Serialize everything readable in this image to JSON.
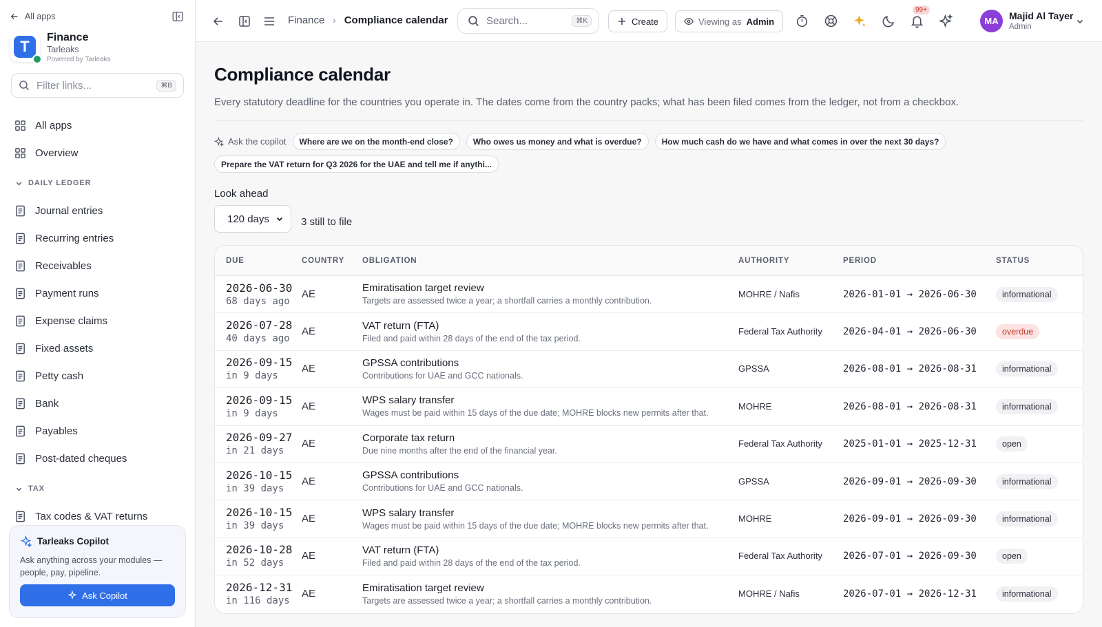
{
  "sidebar": {
    "back_label": "All apps",
    "org": {
      "name": "Finance",
      "company": "Tarleaks",
      "powered": "Powered by Tarleaks",
      "logo_letter": "T"
    },
    "filter_placeholder": "Filter links...",
    "filter_shortcut": "⌘B",
    "top_items": [
      {
        "label": "All apps",
        "icon": "grid-icon"
      },
      {
        "label": "Overview",
        "icon": "grid-icon"
      }
    ],
    "sections": [
      {
        "title": "DAILY LEDGER",
        "items": [
          {
            "label": "Journal entries"
          },
          {
            "label": "Recurring entries"
          },
          {
            "label": "Receivables"
          },
          {
            "label": "Payment runs"
          },
          {
            "label": "Expense claims"
          },
          {
            "label": "Fixed assets"
          },
          {
            "label": "Petty cash"
          },
          {
            "label": "Bank"
          },
          {
            "label": "Payables"
          },
          {
            "label": "Post-dated cheques"
          }
        ]
      },
      {
        "title": "TAX",
        "items": [
          {
            "label": "Tax codes & VAT returns"
          }
        ]
      }
    ],
    "copilot": {
      "title": "Tarleaks Copilot",
      "description": "Ask anything across your modules — people, pay, pipeline.",
      "button": "Ask Copilot"
    }
  },
  "topbar": {
    "breadcrumb_parent": "Finance",
    "breadcrumb_current": "Compliance calendar",
    "search_placeholder": "Search...",
    "search_shortcut": "⌘K",
    "create_label": "Create",
    "viewing_key": "Viewing as",
    "viewing_value": "Admin",
    "notifications_badge": "99+",
    "user": {
      "initials": "MA",
      "name": "Majid Al Tayer",
      "role": "Admin"
    }
  },
  "page": {
    "title": "Compliance calendar",
    "description": "Every statutory deadline for the countries you operate in. The dates come from the country packs; what has been filed comes from the ledger, not from a checkbox.",
    "ask_label": "Ask the copilot",
    "prompts": [
      "Where are we on the month-end close?",
      "Who owes us money and what is overdue?",
      "How much cash do we have and what comes in over the next 30 days?",
      "Prepare the VAT return for Q3 2026 for the UAE and tell me if anythi..."
    ],
    "lookahead_label": "Look ahead",
    "lookahead_value": "120 days",
    "still_to_file": "3 still to file"
  },
  "table": {
    "columns": [
      "DUE",
      "COUNTRY",
      "OBLIGATION",
      "AUTHORITY",
      "PERIOD",
      "STATUS"
    ],
    "rows": [
      {
        "due": "2026-06-30",
        "rel": "68 days ago",
        "country": "AE",
        "title": "Emiratisation target review",
        "desc": "Targets are assessed twice a year; a shortfall carries a monthly contribution.",
        "authority": "MOHRE / Nafis",
        "period": "2026-01-01 → 2026-06-30",
        "status": "informational"
      },
      {
        "due": "2026-07-28",
        "rel": "40 days ago",
        "country": "AE",
        "title": "VAT return (FTA)",
        "desc": "Filed and paid within 28 days of the end of the tax period.",
        "authority": "Federal Tax Authority",
        "period": "2026-04-01 → 2026-06-30",
        "status": "overdue"
      },
      {
        "due": "2026-09-15",
        "rel": "in 9 days",
        "country": "AE",
        "title": "GPSSA contributions",
        "desc": "Contributions for UAE and GCC nationals.",
        "authority": "GPSSA",
        "period": "2026-08-01 → 2026-08-31",
        "status": "informational"
      },
      {
        "due": "2026-09-15",
        "rel": "in 9 days",
        "country": "AE",
        "title": "WPS salary transfer",
        "desc": "Wages must be paid within 15 days of the due date; MOHRE blocks new permits after that.",
        "authority": "MOHRE",
        "period": "2026-08-01 → 2026-08-31",
        "status": "informational"
      },
      {
        "due": "2026-09-27",
        "rel": "in 21 days",
        "country": "AE",
        "title": "Corporate tax return",
        "desc": "Due nine months after the end of the financial year.",
        "authority": "Federal Tax Authority",
        "period": "2025-01-01 → 2025-12-31",
        "status": "open"
      },
      {
        "due": "2026-10-15",
        "rel": "in 39 days",
        "country": "AE",
        "title": "GPSSA contributions",
        "desc": "Contributions for UAE and GCC nationals.",
        "authority": "GPSSA",
        "period": "2026-09-01 → 2026-09-30",
        "status": "informational"
      },
      {
        "due": "2026-10-15",
        "rel": "in 39 days",
        "country": "AE",
        "title": "WPS salary transfer",
        "desc": "Wages must be paid within 15 days of the due date; MOHRE blocks new permits after that.",
        "authority": "MOHRE",
        "period": "2026-09-01 → 2026-09-30",
        "status": "informational"
      },
      {
        "due": "2026-10-28",
        "rel": "in 52 days",
        "country": "AE",
        "title": "VAT return (FTA)",
        "desc": "Filed and paid within 28 days of the end of the tax period.",
        "authority": "Federal Tax Authority",
        "period": "2026-07-01 → 2026-09-30",
        "status": "open"
      },
      {
        "due": "2026-12-31",
        "rel": "in 116 days",
        "country": "AE",
        "title": "Emiratisation target review",
        "desc": "Targets are assessed twice a year; a shortfall carries a monthly contribution.",
        "authority": "MOHRE / Nafis",
        "period": "2026-07-01 → 2026-12-31",
        "status": "informational"
      }
    ]
  },
  "colors": {
    "accent": "#2f6fe8",
    "overdue_bg": "#fde2e2",
    "overdue_fg": "#c0392b",
    "avatar": "#8b3fd8"
  }
}
